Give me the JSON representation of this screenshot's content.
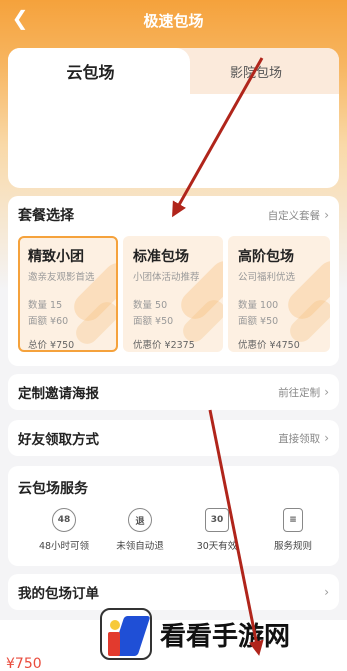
{
  "header": {
    "title": "极速包场",
    "back_icon": "chevron-left-icon"
  },
  "tabs": [
    {
      "label": "云包场",
      "active": true
    },
    {
      "label": "影院包场",
      "active": false
    }
  ],
  "packages": {
    "title": "套餐选择",
    "link_label": "自定义套餐",
    "items": [
      {
        "name": "精致小团",
        "desc": "邀亲友观影首选",
        "quantity": "数量 15",
        "face_value": "面额 ¥60",
        "price": "总价 ¥750",
        "selected": true
      },
      {
        "name": "标准包场",
        "desc": "小团体活动推荐",
        "quantity": "数量 50",
        "face_value": "面额 ¥50",
        "price": "优惠价 ¥2375",
        "selected": false
      },
      {
        "name": "高阶包场",
        "desc": "公司福利优选",
        "quantity": "数量 100",
        "face_value": "面额 ¥50",
        "price": "优惠价 ¥4750",
        "selected": false
      }
    ]
  },
  "poster_row": {
    "title": "定制邀请海报",
    "link_label": "前往定制"
  },
  "claim_row": {
    "title": "好友领取方式",
    "link_label": "直接领取"
  },
  "services": {
    "title": "云包场服务",
    "items": [
      {
        "icon": "48-hours-icon",
        "glyph": "48",
        "label": "48小时可领"
      },
      {
        "icon": "refund-icon",
        "glyph": "退",
        "label": "未领自动退"
      },
      {
        "icon": "calendar-30-icon",
        "glyph": "30",
        "label": "30天有效"
      },
      {
        "icon": "rules-document-icon",
        "glyph": "≡",
        "label": "服务规则"
      }
    ]
  },
  "orders_row": {
    "title": "我的包场订单"
  },
  "bottom": {
    "price": "¥750"
  },
  "watermark": {
    "text": "看看手游网"
  },
  "colors": {
    "accent": "#f5a23c",
    "price_red": "#e94b3c",
    "arrow": "#b0251b"
  }
}
